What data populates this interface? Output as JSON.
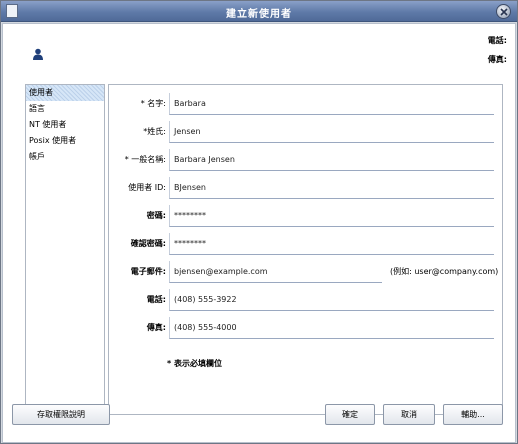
{
  "window": {
    "title": "建立新使用者"
  },
  "header": {
    "phone_label": "電話:",
    "fax_label": "傳真:"
  },
  "sidebar": {
    "items": [
      {
        "label": "使用者",
        "selected": true
      },
      {
        "label": "語言",
        "selected": false
      },
      {
        "label": "NT 使用者",
        "selected": false
      },
      {
        "label": "Posix 使用者",
        "selected": false
      },
      {
        "label": "帳戶",
        "selected": false
      }
    ]
  },
  "form": {
    "fields": [
      {
        "label": "* 名字:",
        "value": "Barbara"
      },
      {
        "label": "*姓氏:",
        "value": "Jensen"
      },
      {
        "label": "* 一般名稱:",
        "value": "Barbara Jensen"
      },
      {
        "label": "使用者 ID:",
        "value": "BJensen"
      },
      {
        "label": "密碼:",
        "value": "********"
      },
      {
        "label": "確認密碼:",
        "value": "********"
      },
      {
        "label": "電子郵件:",
        "value": "bjensen@example.com"
      },
      {
        "label": "電話:",
        "value": "(408) 555-3922"
      },
      {
        "label": "傳真:",
        "value": "(408) 555-4000"
      }
    ],
    "email_hint": "(例如: user@company.com)",
    "required_note": "* 表示必填欄位"
  },
  "buttons": {
    "access": "存取權限說明",
    "ok": "確定",
    "cancel": "取消",
    "help": "輔助..."
  },
  "colors": {
    "titlebar": "#5f7aa8",
    "window_bg": "#d4d9e0",
    "selection": "#d6e6f7",
    "user_icon": "#1f3f7a"
  }
}
